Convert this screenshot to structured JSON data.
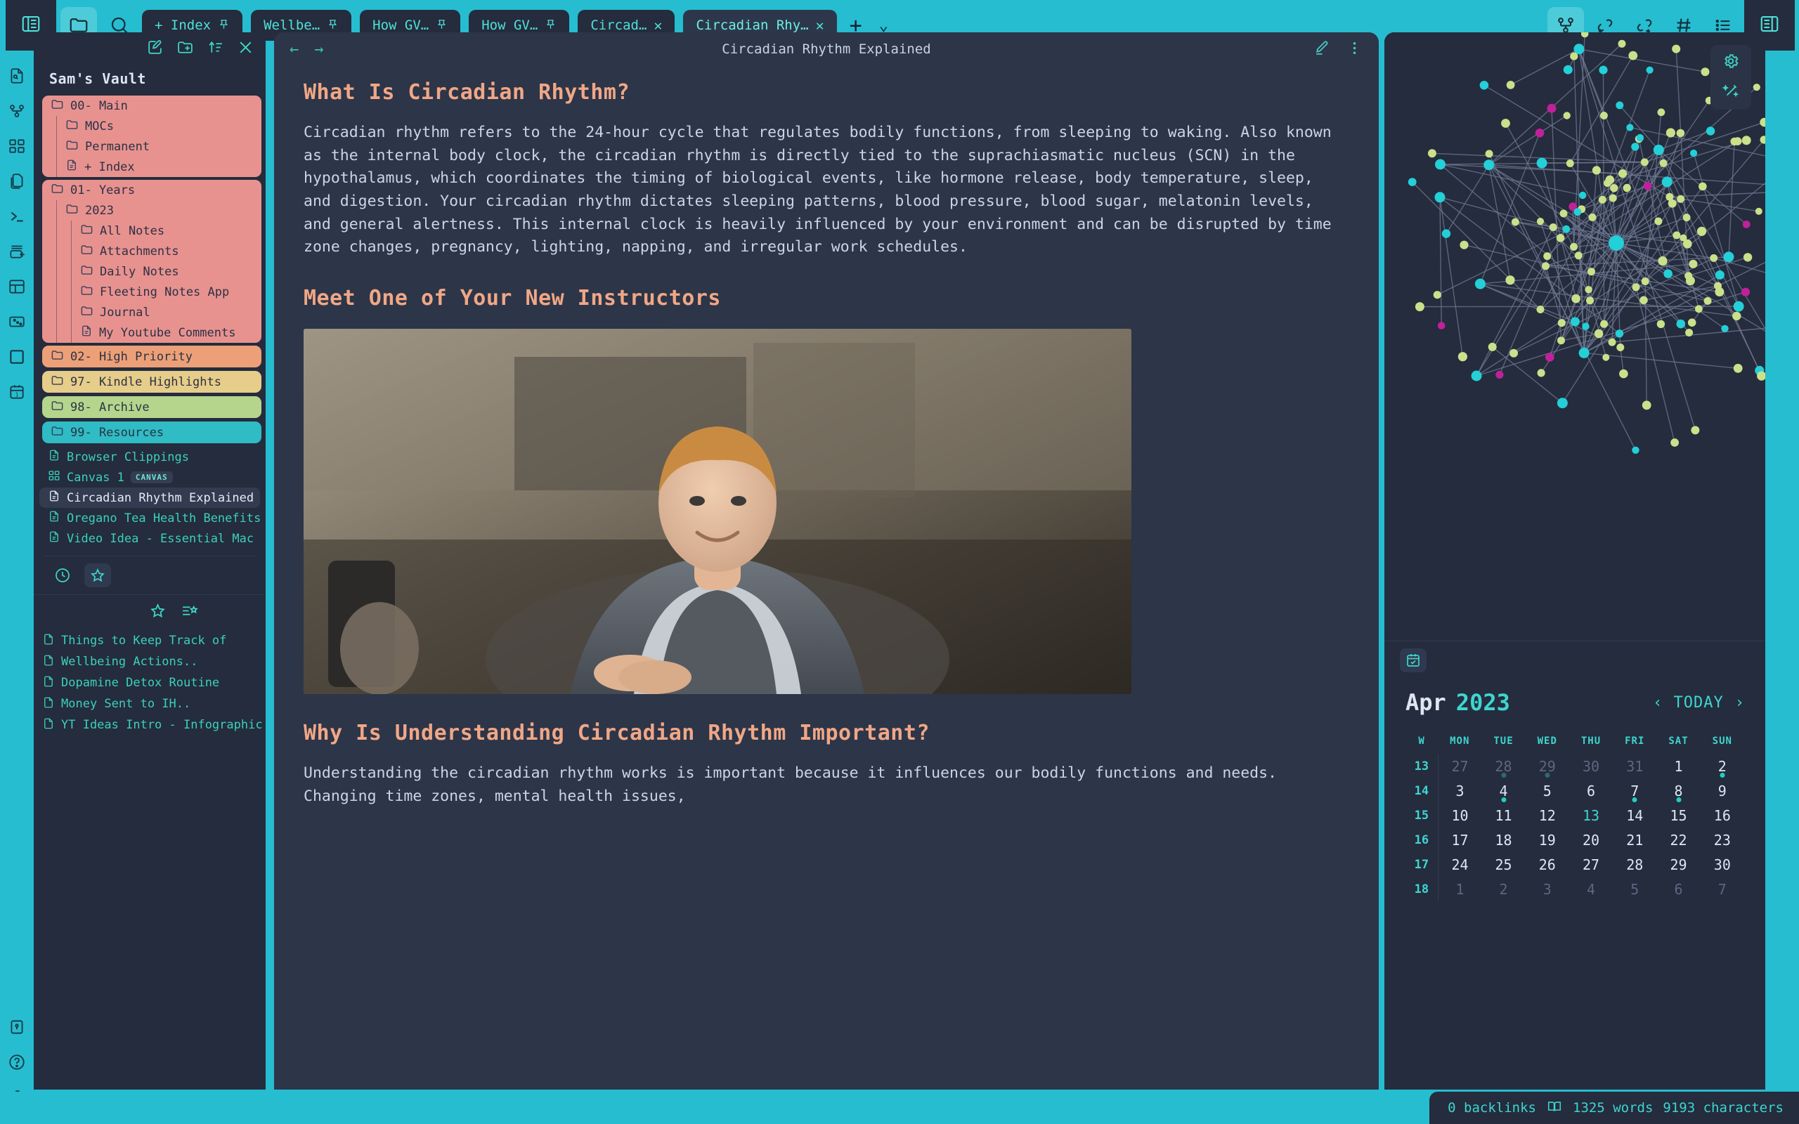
{
  "topbar": {
    "left_icons": [
      {
        "name": "toggle-left-sidebar-icon",
        "label": "Toggle left sidebar"
      },
      {
        "name": "folder-icon",
        "label": "File explorer"
      },
      {
        "name": "search-icon",
        "label": "Search"
      }
    ],
    "tabs": [
      {
        "label": "+ Index",
        "pinned": true,
        "active": false,
        "closable": false
      },
      {
        "label": "Wellbe…",
        "pinned": true,
        "active": false,
        "closable": false
      },
      {
        "label": "How GV…",
        "pinned": true,
        "active": false,
        "closable": false
      },
      {
        "label": "How GV…",
        "pinned": true,
        "active": false,
        "closable": false
      },
      {
        "label": "Circad…",
        "pinned": false,
        "active": false,
        "closable": true
      },
      {
        "label": "Circadian Rhy…",
        "pinned": false,
        "active": true,
        "closable": true
      }
    ],
    "new_tab_label": "+",
    "tab_list_caret": "⌄",
    "right_icons": [
      {
        "name": "graph-view-icon",
        "active": true
      },
      {
        "name": "backlinks-icon",
        "active": false
      },
      {
        "name": "outgoing-links-icon",
        "active": false
      },
      {
        "name": "tags-icon",
        "active": false
      },
      {
        "name": "outline-icon",
        "active": false
      }
    ],
    "right_toggle": {
      "name": "toggle-right-sidebar-icon"
    }
  },
  "ribbon": {
    "items": [
      {
        "name": "quick-switcher-icon"
      },
      {
        "name": "graph-view-icon"
      },
      {
        "name": "canvas-icon"
      },
      {
        "name": "copy-files-icon"
      },
      {
        "name": "terminal-icon"
      },
      {
        "name": "new-card-icon"
      },
      {
        "name": "layout-icon"
      },
      {
        "name": "random-note-icon"
      },
      {
        "name": "square-icon"
      },
      {
        "name": "daily-note-icon"
      }
    ],
    "bottom_items": [
      {
        "name": "bookmark-icon"
      },
      {
        "name": "help-icon"
      },
      {
        "name": "settings-gear-icon"
      }
    ]
  },
  "sidebar": {
    "toolbar": [
      {
        "name": "new-note-icon"
      },
      {
        "name": "new-folder-icon"
      },
      {
        "name": "sort-icon"
      },
      {
        "name": "collapse-all-icon"
      }
    ],
    "vault_name": "Sam's Vault",
    "groups": [
      {
        "color": "#e8928f",
        "rows": [
          {
            "label": "00- Main",
            "type": "folder",
            "depth": 0
          },
          {
            "label": "MOCs",
            "type": "folder",
            "depth": 1
          },
          {
            "label": "Permanent",
            "type": "folder",
            "depth": 1
          },
          {
            "label": "+ Index",
            "type": "file",
            "depth": 1
          }
        ]
      },
      {
        "color": "#e8928f",
        "rows": [
          {
            "label": "01- Years",
            "type": "folder",
            "depth": 0
          },
          {
            "label": "2023",
            "type": "folder",
            "depth": 1
          },
          {
            "label": "All Notes",
            "type": "folder",
            "depth": 2
          },
          {
            "label": "Attachments",
            "type": "folder",
            "depth": 2
          },
          {
            "label": "Daily Notes",
            "type": "folder",
            "depth": 2
          },
          {
            "label": "Fleeting Notes App",
            "type": "folder",
            "depth": 2
          },
          {
            "label": "Journal",
            "type": "folder",
            "depth": 2
          },
          {
            "label": "My Youtube Comments",
            "type": "file",
            "depth": 2
          }
        ]
      }
    ],
    "bar_folders": [
      {
        "label": "02- High Priority",
        "color": "#eda077"
      },
      {
        "label": "97- Kindle Highlights",
        "color": "#e7cd8a"
      },
      {
        "label": "98- Archive",
        "color": "#b5d58c"
      },
      {
        "label": "99- Resources",
        "color": "#2fbcc4"
      }
    ],
    "loose_files": [
      {
        "label": "Browser Clippings",
        "type": "file",
        "selected": false
      },
      {
        "label": "Canvas 1",
        "type": "canvas",
        "badge": "CANVAS",
        "selected": false
      },
      {
        "label": "Circadian Rhythm Explained",
        "type": "file",
        "selected": true
      },
      {
        "label": "Oregano Tea Health Benefits",
        "type": "file",
        "selected": false
      },
      {
        "label": "Video Idea - Essential Mac A…",
        "type": "file",
        "selected": false
      }
    ],
    "panel_tabs": [
      {
        "name": "recent-files-tab",
        "active": false
      },
      {
        "name": "bookmarks-tab",
        "active": true
      }
    ],
    "star_toolbar": [
      {
        "name": "add-bookmark-icon"
      },
      {
        "name": "bookmark-options-icon"
      }
    ],
    "starred": [
      {
        "label": "Things to Keep Track of"
      },
      {
        "label": "Wellbeing Actions.."
      },
      {
        "label": "Dopamine Detox Routine"
      },
      {
        "label": "Money Sent to IH.."
      },
      {
        "label": "YT Ideas Intro - Infographic"
      }
    ]
  },
  "note": {
    "nav_back": "←",
    "nav_forward": "→",
    "title": "Circadian Rhythm Explained",
    "actions": [
      {
        "name": "edit-pencil-icon"
      },
      {
        "name": "more-options-icon"
      }
    ],
    "blocks": [
      {
        "type": "h1",
        "text": "What Is Circadian Rhythm?"
      },
      {
        "type": "p",
        "text": "Circadian rhythm refers to the 24-hour cycle that regulates bodily functions, from sleeping to waking. Also known as the internal body clock, the circadian rhythm is directly tied to the suprachiasmatic nucleus (SCN) in the hypothalamus, which coordinates the timing of biological events, like hormone release, body temperature, sleep, and digestion. Your circadian rhythm dictates sleeping patterns, blood pressure, blood sugar, melatonin levels, and general alertness. This internal clock is heavily influenced by your environment and can be disrupted by time zone changes, pregnancy, lighting, napping, and irregular work schedules."
      },
      {
        "type": "h1",
        "text": "Meet One of Your New Instructors"
      },
      {
        "type": "image",
        "alt": "Portrait of a smiling man in a grey vest seated indoors"
      },
      {
        "type": "h1",
        "text": "Why Is Understanding Circadian Rhythm Important?"
      },
      {
        "type": "p",
        "text": "Understanding the circadian rhythm works is important because it influences our bodily functions and needs. Changing time zones, mental health issues,"
      }
    ]
  },
  "graph": {
    "tools": [
      {
        "name": "graph-settings-gear-icon"
      },
      {
        "name": "graph-restore-wand-icon"
      }
    ],
    "colors": {
      "node_primary": "#24cfd8",
      "node_secondary": "#cbe08a",
      "node_accent": "#c0219a",
      "edge": "#6f7992",
      "background": "#242c3d"
    }
  },
  "calendar": {
    "panel_icon": "calendar-check-icon",
    "month": "Apr",
    "year": "2023",
    "prev_label": "‹",
    "today_label": "TODAY",
    "next_label": "›",
    "day_headers": [
      "W",
      "MON",
      "TUE",
      "WED",
      "THU",
      "FRI",
      "SAT",
      "SUN"
    ],
    "weeks": [
      {
        "w": "13",
        "days": [
          {
            "n": "27",
            "adj": true
          },
          {
            "n": "28",
            "adj": true,
            "dot": "faint"
          },
          {
            "n": "29",
            "adj": true,
            "dot": "faint"
          },
          {
            "n": "30",
            "adj": true
          },
          {
            "n": "31",
            "adj": true
          },
          {
            "n": "1"
          },
          {
            "n": "2",
            "dot": "full"
          }
        ]
      },
      {
        "w": "14",
        "days": [
          {
            "n": "3"
          },
          {
            "n": "4",
            "dot": "full"
          },
          {
            "n": "5"
          },
          {
            "n": "6"
          },
          {
            "n": "7",
            "dot": "full"
          },
          {
            "n": "8",
            "dot": "full"
          },
          {
            "n": "9"
          }
        ]
      },
      {
        "w": "15",
        "days": [
          {
            "n": "10"
          },
          {
            "n": "11"
          },
          {
            "n": "12"
          },
          {
            "n": "13",
            "today": true
          },
          {
            "n": "14"
          },
          {
            "n": "15"
          },
          {
            "n": "16"
          }
        ]
      },
      {
        "w": "16",
        "days": [
          {
            "n": "17"
          },
          {
            "n": "18"
          },
          {
            "n": "19"
          },
          {
            "n": "20"
          },
          {
            "n": "21"
          },
          {
            "n": "22"
          },
          {
            "n": "23"
          }
        ]
      },
      {
        "w": "17",
        "days": [
          {
            "n": "24"
          },
          {
            "n": "25"
          },
          {
            "n": "26"
          },
          {
            "n": "27"
          },
          {
            "n": "28"
          },
          {
            "n": "29"
          },
          {
            "n": "30"
          }
        ]
      },
      {
        "w": "18",
        "days": [
          {
            "n": "1",
            "adj": true
          },
          {
            "n": "2",
            "adj": true
          },
          {
            "n": "3",
            "adj": true
          },
          {
            "n": "4",
            "adj": true
          },
          {
            "n": "5",
            "adj": true
          },
          {
            "n": "6",
            "adj": true
          },
          {
            "n": "7",
            "adj": true
          }
        ]
      }
    ]
  },
  "statusbar": {
    "backlinks": "0 backlinks",
    "reading_icon": "book-icon",
    "words": "1325 words",
    "characters": "9193 characters"
  }
}
